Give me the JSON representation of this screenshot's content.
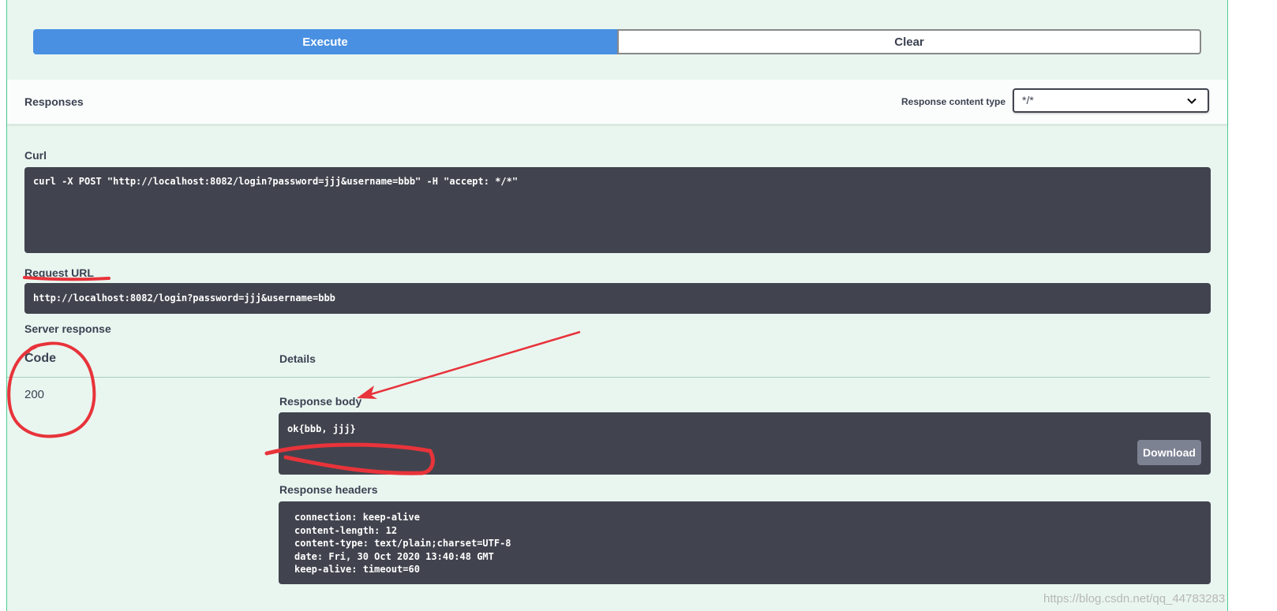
{
  "actions": {
    "execute_label": "Execute",
    "clear_label": "Clear"
  },
  "responses": {
    "title": "Responses",
    "content_type_label": "Response content type",
    "content_type_value": "*/*"
  },
  "curl": {
    "label": "Curl",
    "command": "curl -X POST \"http://localhost:8082/login?password=jjj&username=bbb\" -H \"accept: */*\""
  },
  "request_url": {
    "label": "Request URL",
    "value": "http://localhost:8082/login?password=jjj&username=bbb"
  },
  "server_response": {
    "label": "Server response",
    "code_header": "Code",
    "details_header": "Details",
    "code": "200",
    "response_body_label": "Response body",
    "response_body": "ok{bbb, jjj}",
    "download_label": "Download",
    "response_headers_label": "Response headers",
    "response_headers": [
      "connection: keep-alive",
      "content-length: 12",
      "content-type: text/plain;charset=UTF-8",
      "date: Fri, 30 Oct 2020 13:40:48 GMT",
      "keep-alive: timeout=60"
    ]
  },
  "watermark": "https://blog.csdn.net/qq_44783283",
  "colors": {
    "execute": "#4990e2",
    "panel_bg": "#e9f6f0",
    "panel_border": "#49cc90",
    "code_bg": "#41444e",
    "annotation": "#e8333a"
  },
  "icons": {
    "select_chevron": "chevron-down-icon"
  }
}
